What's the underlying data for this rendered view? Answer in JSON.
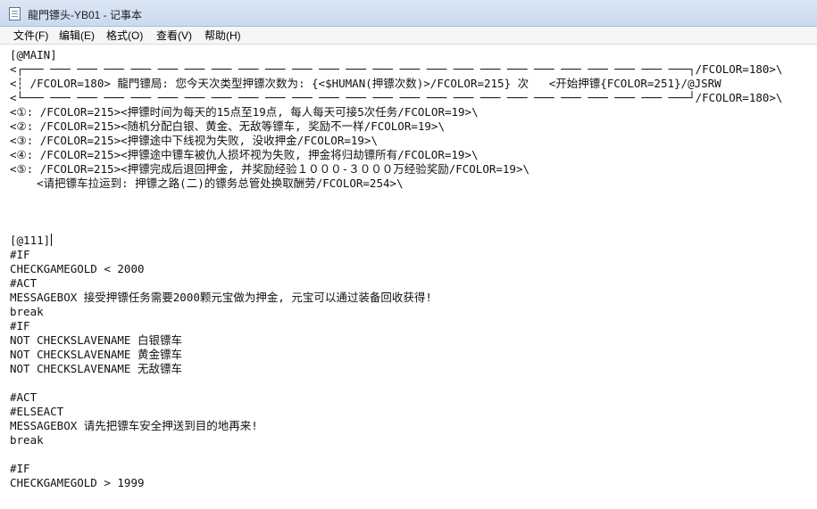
{
  "window": {
    "title": "龍門镖头-YB01 - 记事本"
  },
  "menu": [
    "文件(F)",
    "编辑(E)",
    "格式(O)",
    "查看(V)",
    "帮助(H)"
  ],
  "document": {
    "lines": [
      "[@MAIN]",
      "<┌─── ─── ─── ─── ─── ─── ─── ─── ─── ─── ─── ─── ─── ─── ─── ─── ─── ─── ─── ─── ─── ─── ─── ─── ───┐/FCOLOR=180>\\",
      "<┆ /FCOLOR=180> 龍門镖局: 您今天次类型押镖次数为: {<$HUMAN(押镖次数)>/FCOLOR=215} 次   <开始押镖{FCOLOR=251}/@JSRW",
      "<└─── ─── ─── ─── ─── ─── ─── ─── ─── ─── ─── ─── ─── ─── ─── ─── ─── ─── ─── ─── ─── ─── ─── ─── ───┘/FCOLOR=180>\\",
      "<①: /FCOLOR=215><押镖时间为每天的15点至19点, 每人每天可接5次任务/FCOLOR=19>\\",
      "<②: /FCOLOR=215><随机分配白银、黄金、无敌等镖车, 奖励不一样/FCOLOR=19>\\",
      "<③: /FCOLOR=215><押镖途中下线视为失败, 没收押金/FCOLOR=19>\\",
      "<④: /FCOLOR=215><押镖途中镖车被仇人损坏视为失败, 押金将归劫镖所有/FCOLOR=19>\\",
      "<⑤: /FCOLOR=215><押镖完成后退回押金, 并奖励经验１０００-３０００万经验奖励/FCOLOR=19>\\",
      "    <请把镖车拉运到: 押镖之路(二)的镖务总管处换取酬劳/FCOLOR=254>\\",
      "",
      "",
      "",
      "[@111]",
      "#IF",
      "CHECKGAMEGOLD < 2000",
      "#ACT",
      "MESSAGEBOX 接受押镖任务需要2000颗元宝做为押金, 元宝可以通过装备回收获得!",
      "break",
      "#IF",
      "NOT CHECKSLAVENAME 白银镖车",
      "NOT CHECKSLAVENAME 黄金镖车",
      "NOT CHECKSLAVENAME 无敌镖车",
      "",
      "#ACT",
      "#ELSEACT",
      "MESSAGEBOX 请先把镖车安全押送到目的地再来!",
      "break",
      "",
      "#IF",
      "CHECKGAMEGOLD > 1999"
    ]
  }
}
